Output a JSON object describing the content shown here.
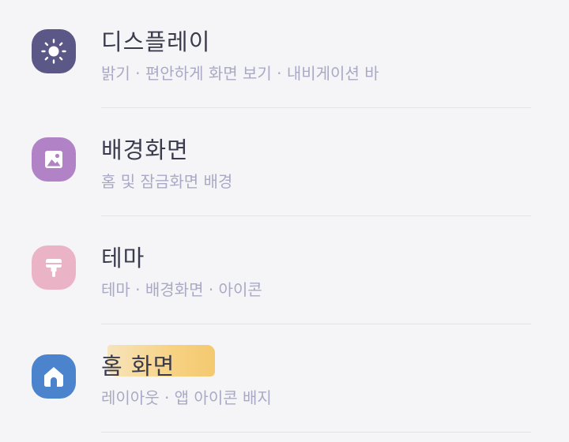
{
  "settings": {
    "items": [
      {
        "title": "디스플레이",
        "subtitle": "밝기 · 편안하게 화면 보기 · 내비게이션 바",
        "icon": "sun-icon",
        "icon_color": "#5b5887"
      },
      {
        "title": "배경화면",
        "subtitle": "홈 및 잠금화면 배경",
        "icon": "image-icon",
        "icon_color": "#b183c6"
      },
      {
        "title": "테마",
        "subtitle": "테마 · 배경화면 · 아이콘",
        "icon": "paint-brush-icon",
        "icon_color": "#eab4c6"
      },
      {
        "title": "홈 화면",
        "subtitle": "레이아웃 · 앱 아이콘 배지",
        "icon": "home-icon",
        "icon_color": "#4b84cc",
        "highlighted": true,
        "highlight_color": "#f5c866"
      }
    ]
  }
}
